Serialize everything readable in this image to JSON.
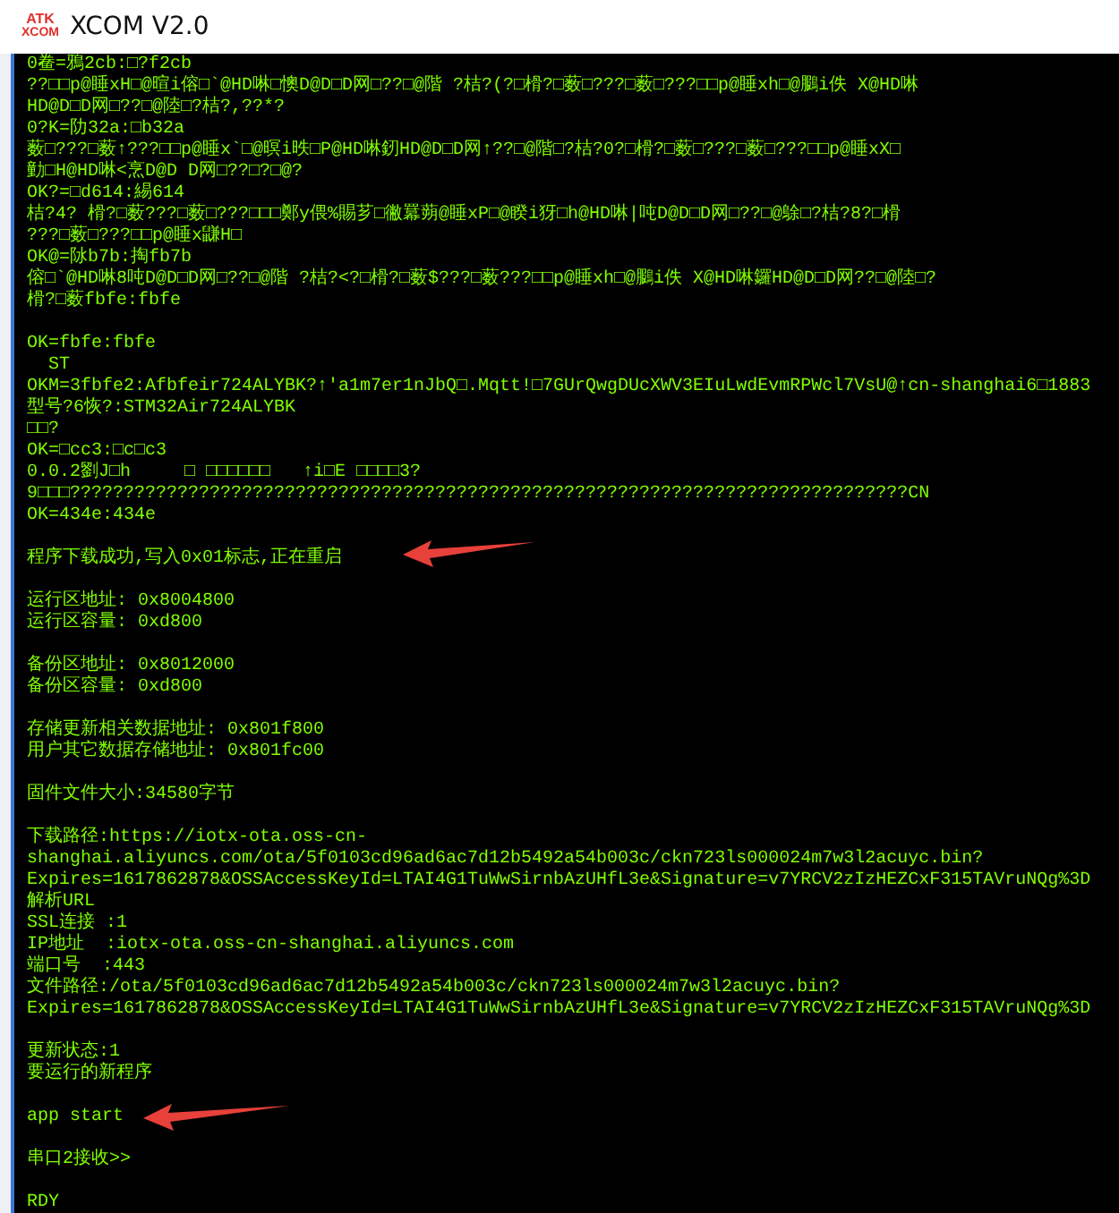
{
  "window": {
    "title": "XCOM V2.0",
    "logo_top": "ATK",
    "logo_bottom": "XCOM"
  },
  "terminal": {
    "blocks": [
      [
        "0鲞=鴉2cb:□?f2cb",
        "??□□p@睡xH□@暄i傛□`@HD啉□懊D@D□D网□??□@階 ?桔?(?□榾?□薮□???□薮□???□□p@睡xh□@鵩i佚 X@HD啉",
        "HD@D□D网□??□@陸□?桔?,??*?",
        "0?K=阞32a:□b32a",
        "薮□???□薮↑???□□p@睡x`□@暝i昳□P@HD啉釰HD@D□D网↑??□@階□?桔?0?□榾?□薮□???□薮□???□□p@睡xX□",
        "勭□H@HD啉<烹D@D D网□??□?□@?",
        "OK?=□d614:緆614",
        "桔?4? 榾?□薮???□薮□???□□□鄭y偎%賜芗□徶羃蒴@睡xP□@睽i犽□h@HD啉|吨D@D□D网□??□@鵌□?桔?8?□榾",
        "???□薮□???□□p@睡x鼸H□",
        "OK@=阥b7b:掏fb7b",
        "傛□`@HD啉8吨D@D□D网□??□@階 ?桔?<?□榾?□薮$???□薮???□□p@睡xh□@鵩i佚 X@HD啉鑼HD@D□D网??□@陸□?",
        "榾?□薮fbfe:fbfe"
      ],
      [
        "OK=fbfe:fbfe",
        "  ST",
        "OKM=3fbfe2:Afbfeir724ALYBK?↑'a1m7er1nJbQ□.Mqtt!□7GUrQwgDUcXWV3EIuLwdEvmRPWcl7VsU@↑cn-shanghai6□1883",
        "型号?6恢?:STM32Air724ALYBK",
        "□□?",
        "OK=□cc3:□c□c3",
        "0.0.2劉J□h     □ □□□□□□   ↑i□E □□□□3?",
        "9□□□??????????????????????????????????????????????????????????????????????????????CN",
        "OK=434e:434e"
      ],
      [
        "程序下载成功,写入0x01标志,正在重启"
      ],
      [
        "运行区地址: 0x8004800",
        "运行区容量: 0xd800"
      ],
      [
        "备份区地址: 0x8012000",
        "备份区容量: 0xd800"
      ],
      [
        "存储更新相关数据地址: 0x801f800",
        "用户其它数据存储地址: 0x801fc00"
      ],
      [
        "固件文件大小:34580字节"
      ],
      [
        "下载路径:https://iotx-ota.oss-cn-",
        "shanghai.aliyuncs.com/ota/5f0103cd96ad6ac7d12b5492a54b003c/ckn723ls000024m7w3l2acuyc.bin?",
        "Expires=1617862878&OSSAccessKeyId=LTAI4G1TuWwSirnbAzUHfL3e&Signature=v7YRCV2zIzHEZCxF315TAVruNQg%3D",
        "解析URL",
        "SSL连接 :1",
        "IP地址  :iotx-ota.oss-cn-shanghai.aliyuncs.com",
        "端口号  :443",
        "文件路径:/ota/5f0103cd96ad6ac7d12b5492a54b003c/ckn723ls000024m7w3l2acuyc.bin?",
        "Expires=1617862878&OSSAccessKeyId=LTAI4G1TuWwSirnbAzUHfL3e&Signature=v7YRCV2zIzHEZCxF315TAVruNQg%3D"
      ],
      [
        "更新状态:1",
        "要运行的新程序"
      ],
      [
        "app start"
      ],
      [
        "串口2接收>>"
      ],
      [
        "RDY"
      ]
    ]
  }
}
